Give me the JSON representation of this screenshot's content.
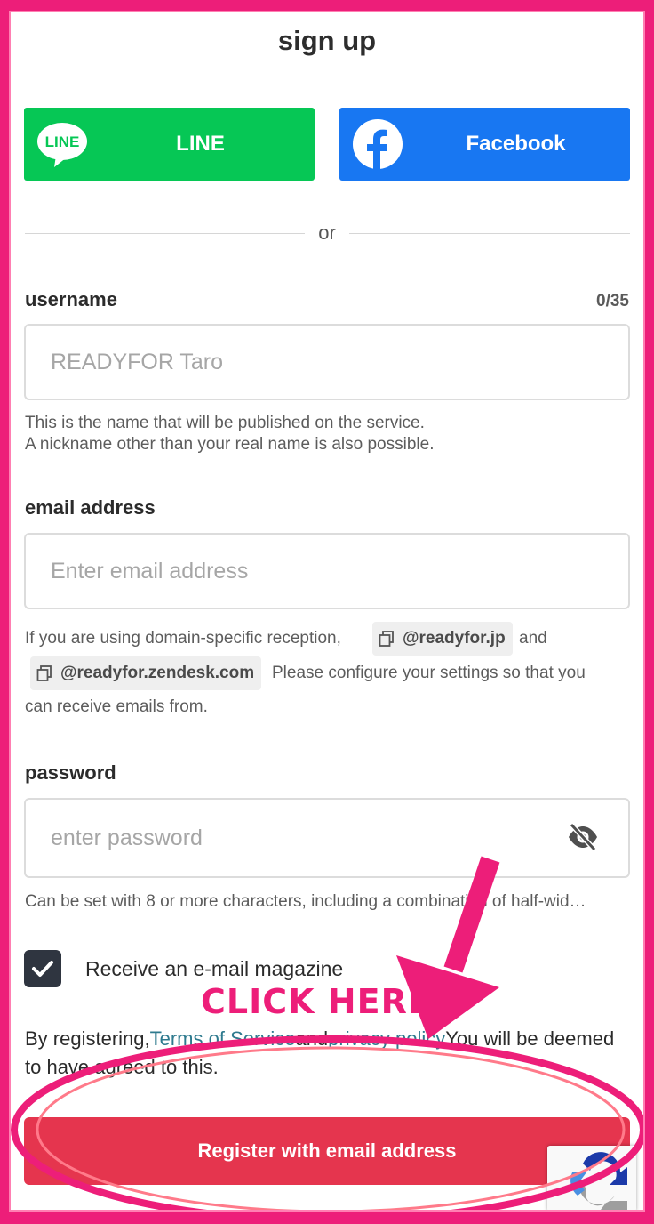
{
  "page": {
    "title": "sign up"
  },
  "social": {
    "line_label": "LINE",
    "line_logo_text": "LINE",
    "facebook_label": "Facebook"
  },
  "divider": {
    "text": "or"
  },
  "username": {
    "label": "username",
    "counter": "0/35",
    "placeholder": "READYFOR Taro",
    "value": "",
    "help_line1": "This is the name that will be published on the service.",
    "help_line2": "A nickname other than your real name is also possible."
  },
  "email": {
    "label": "email address",
    "placeholder": "Enter email address",
    "value": "",
    "help_prefix": "If you are using domain-specific reception,",
    "domain1": "@readyfor.jp",
    "help_and": "and",
    "domain2": "@readyfor.zendesk.com",
    "help_suffix1": "Please configure your settings so that you",
    "help_suffix2": "can receive emails from."
  },
  "password": {
    "label": "password",
    "placeholder": "enter password",
    "value": "",
    "help": "Can be set with 8 or more characters, including a combination of half-wid…"
  },
  "newsletter": {
    "checked": true,
    "label": "Receive an e-mail magazine"
  },
  "terms": {
    "prefix": "By registering,",
    "tos_link": "Terms of Service",
    "and": "and",
    "privacy_link": "privacy policy",
    "suffix": "You will be deemed to have agreed to this."
  },
  "submit": {
    "label": "Register with email address"
  },
  "annotation": {
    "callout": "CLICK HERE",
    "color": "#ed1e79"
  },
  "colors": {
    "line_green": "#06c755",
    "facebook_blue": "#1877f2",
    "submit_red": "#e5354e",
    "link_teal": "#2e7a8e"
  },
  "icons": {
    "line_logo": "line-logo-icon",
    "facebook_logo": "facebook-logo-icon",
    "copy": "copy-icon",
    "password_visibility": "eye-slash-icon",
    "checkbox_check": "check-icon",
    "recaptcha": "recaptcha-icon"
  }
}
